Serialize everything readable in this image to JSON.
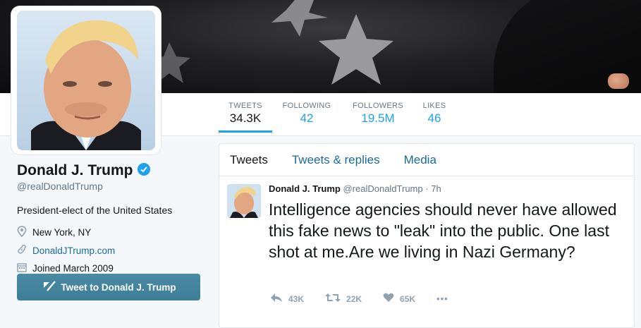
{
  "banner": {
    "description_icon": "flag-stars-banner"
  },
  "nav": {
    "items": [
      {
        "label": "TWEETS",
        "value": "34.3K"
      },
      {
        "label": "FOLLOWING",
        "value": "42"
      },
      {
        "label": "FOLLOWERS",
        "value": "19.5M"
      },
      {
        "label": "LIKES",
        "value": "46"
      }
    ]
  },
  "profile": {
    "name": "Donald J. Trump",
    "handle": "@realDonaldTrump",
    "bio": "President-elect of the United States",
    "location": "New York, NY",
    "website": "DonaldJTrump.com",
    "joined": "Joined March 2009",
    "tweet_to_label": "Tweet to Donald J. Trump"
  },
  "timeline": {
    "tabs": [
      "Tweets",
      "Tweets & replies",
      "Media"
    ]
  },
  "tweet": {
    "name": "Donald J. Trump",
    "handle": "@realDonaldTrump",
    "separator": "·",
    "time": "7h",
    "text": "Intelligence agencies should never have allowed this fake news to \"leak\" into the public. One last shot at me.Are we living in Nazi Germany?",
    "replies": "43K",
    "retweets": "22K",
    "likes": "65K",
    "more": "•••"
  },
  "colors": {
    "accent": "#1da1f2",
    "link": "#1b6b9a",
    "button": "#3d7d96",
    "verified": "#1da1f2"
  }
}
